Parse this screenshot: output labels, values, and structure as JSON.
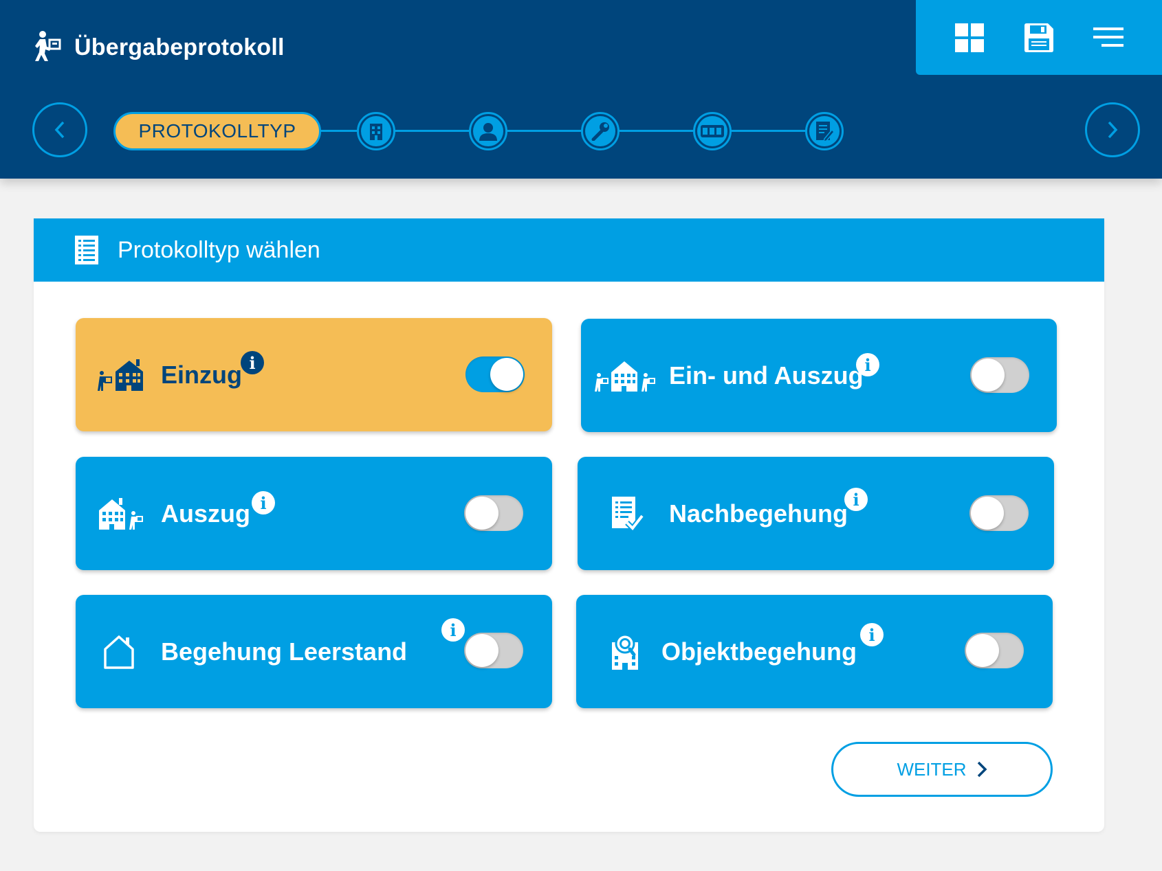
{
  "app": {
    "title": "Übergabeprotokoll",
    "icon": "person-moving-box-icon"
  },
  "toolbar": {
    "items": [
      {
        "name": "grid-icon"
      },
      {
        "name": "save-icon"
      },
      {
        "name": "menu-icon"
      }
    ]
  },
  "stepper": {
    "active_label": "PROTOKOLLTYP",
    "steps": [
      "building-icon",
      "person-icon",
      "wrench-icon",
      "meter-icon",
      "document-edit-icon"
    ]
  },
  "panel": {
    "title": "Protokolltyp wählen",
    "icon": "checklist-icon"
  },
  "options": [
    {
      "label": "Einzug",
      "selected": true,
      "icon": "move-in-icon"
    },
    {
      "label": "Ein- und Auszug",
      "selected": false,
      "icon": "move-in-out-icon"
    },
    {
      "label": "Auszug",
      "selected": false,
      "icon": "move-out-icon"
    },
    {
      "label": "Nachbegehung",
      "selected": false,
      "icon": "checklist-check-icon"
    },
    {
      "label": "Begehung Leerstand",
      "selected": false,
      "icon": "empty-house-icon"
    },
    {
      "label": "Objektbegehung",
      "selected": false,
      "icon": "building-search-icon"
    }
  ],
  "info_glyph": "i",
  "weiter": {
    "label": "WEITER"
  },
  "colors": {
    "navy": "#00457c",
    "blue": "#009fe3",
    "yellow": "#f5bd55",
    "background": "#f2f2f2"
  }
}
